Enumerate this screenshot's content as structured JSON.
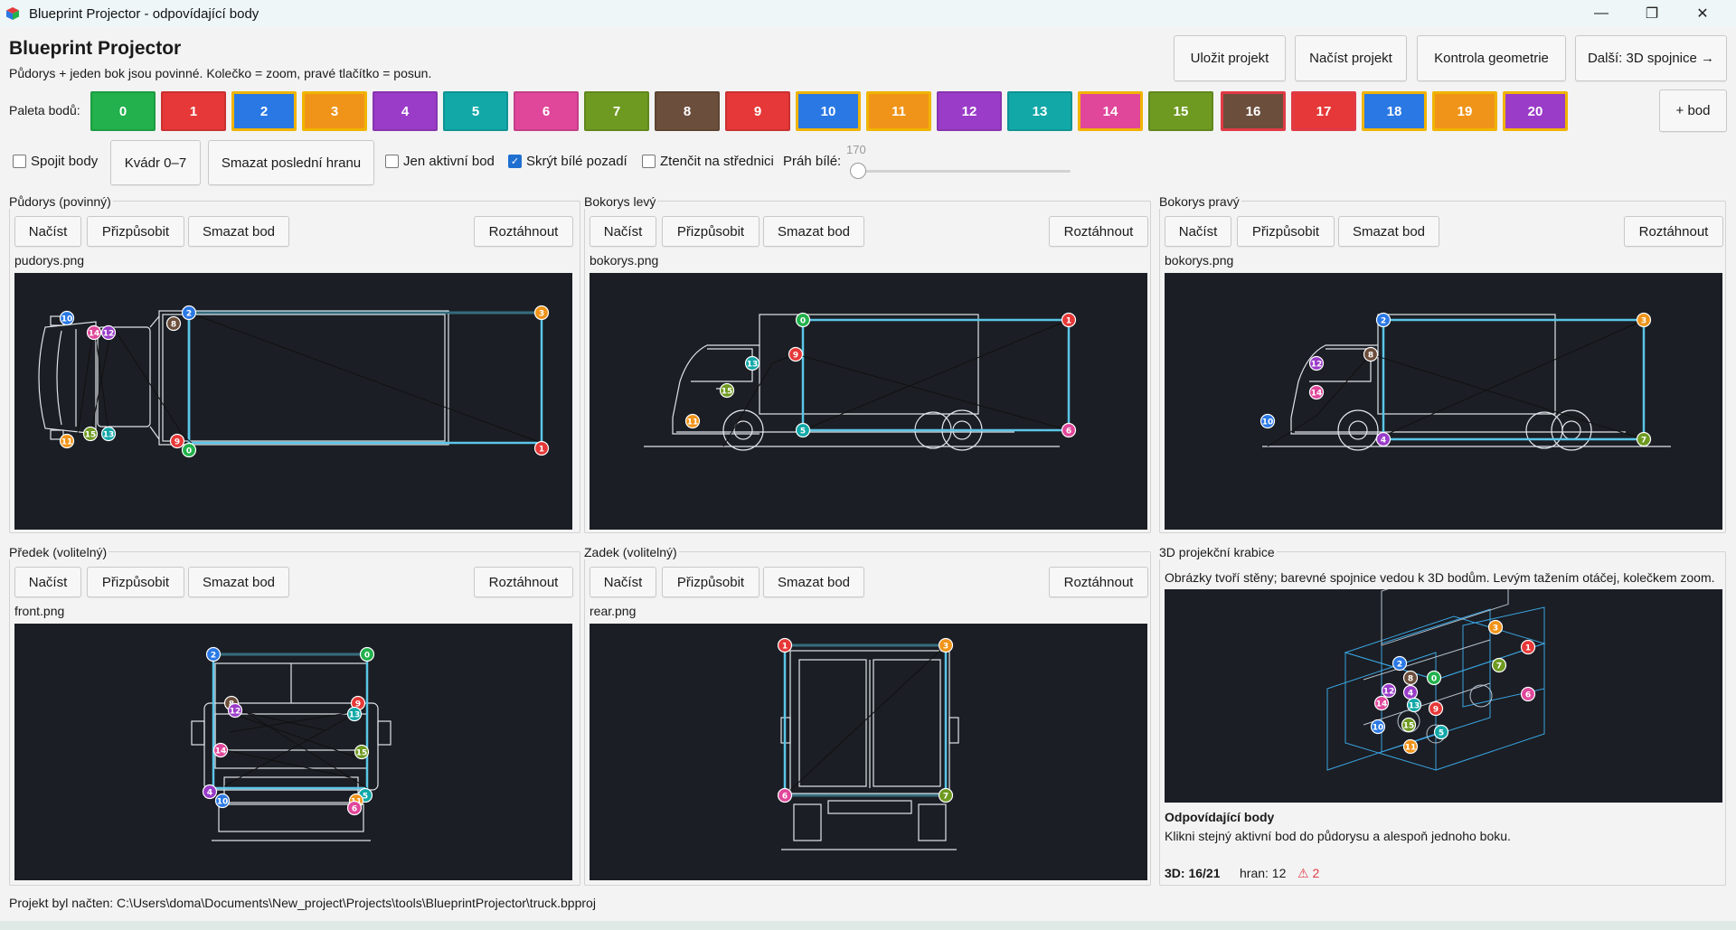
{
  "window": {
    "title": "Blueprint Projector - odpovídající body",
    "minimize_glyph": "—",
    "maximize_glyph": "❐",
    "close_glyph": "✕"
  },
  "header": {
    "app_title": "Blueprint Projector",
    "subtitle": "Půdorys + jeden bok jsou povinné. Kolečko = zoom, pravé tlačítko = posun.",
    "save_label": "Uložit projekt",
    "load_label": "Načíst projekt",
    "check_label": "Kontrola geometrie",
    "next_label": "Další: 3D spojnice →"
  },
  "palette": {
    "label": "Paleta bodů:",
    "add_label": "+ bod",
    "swatches": [
      {
        "label": "0",
        "color": "#22b14c"
      },
      {
        "label": "1",
        "color": "#e63838"
      },
      {
        "label": "2",
        "color": "#2a78e4"
      },
      {
        "label": "3",
        "color": "#f09419"
      },
      {
        "label": "4",
        "color": "#9a3cc8"
      },
      {
        "label": "5",
        "color": "#12a8a8"
      },
      {
        "label": "6",
        "color": "#e0479a"
      },
      {
        "label": "7",
        "color": "#6f9a21"
      },
      {
        "label": "8",
        "color": "#6b4e3b"
      },
      {
        "label": "9",
        "color": "#e63838"
      },
      {
        "label": "10",
        "color": "#2a78e4"
      },
      {
        "label": "11",
        "color": "#f09419"
      },
      {
        "label": "12",
        "color": "#9a3cc8"
      },
      {
        "label": "13",
        "color": "#12a8a8"
      },
      {
        "label": "14",
        "color": "#e0479a"
      },
      {
        "label": "15",
        "color": "#6f9a21"
      },
      {
        "label": "16",
        "color": "#6b4e3b"
      },
      {
        "label": "17",
        "color": "#e63838"
      },
      {
        "label": "18",
        "color": "#2a78e4"
      },
      {
        "label": "19",
        "color": "#f09419"
      },
      {
        "label": "20",
        "color": "#9a3cc8"
      }
    ]
  },
  "options": {
    "connect_label": "Spojit body",
    "connect_checked": false,
    "cuboid_label": "Kvádr 0–7",
    "delete_edge_label": "Smazat poslední hranu",
    "only_active_label": "Jen aktivní bod",
    "only_active_checked": false,
    "hide_white_label": "Skrýt bílé pozadí",
    "hide_white_checked": true,
    "thin_label": "Ztenčit na střednici",
    "thin_checked": false,
    "threshold_label": "Práh bílé:",
    "threshold_value": "170",
    "threshold_max": 255
  },
  "panels": {
    "load_label": "Načíst",
    "fit_label": "Přizpůsobit",
    "delete_point_label": "Smazat bod",
    "stretch_label": "Roztáhnout",
    "top": {
      "title": "Půdorys (povinný)",
      "file": "pudorys.png"
    },
    "left": {
      "title": "Bokorys levý",
      "file": "bokorys.png"
    },
    "right": {
      "title": "Bokorys pravý",
      "file": "bokorys.png"
    },
    "front": {
      "title": "Předek (volitelný)",
      "file": "front.png"
    },
    "rear": {
      "title": "Zadek (volitelný)",
      "file": "rear.png"
    },
    "box3d": {
      "title": "3D projekční krabice",
      "hint": "Obrázky tvoří stěny; barevné spojnice vedou k 3D bodům. Levým tažením otáčej, kolečkem zoom.",
      "matches_title": "Odpovídající body",
      "matches_hint": "Klikni stejný aktivní bod do půdorysu a alespoň jednoho boku.",
      "count_3d": "3D: 16/21",
      "edges": "hran: 12",
      "warnings": "⚠ 2"
    }
  },
  "status": {
    "message": "Projekt byl načten: C:\\Users\\doma\\Documents\\New_project\\Projects\\tools\\BlueprintProjector\\truck.bpproj"
  },
  "icons": [
    "app-cube-icon",
    "minimize-icon",
    "maximize-icon",
    "close-icon",
    "checkbox-icon",
    "warning-icon"
  ],
  "colors": {
    "accent": "#1f6fd1",
    "canvas_bg": "#1b1e24",
    "blueprint_edge": "#5bc6e8",
    "active_swatch_border": "#f0b400",
    "warning": "#e03a45"
  }
}
